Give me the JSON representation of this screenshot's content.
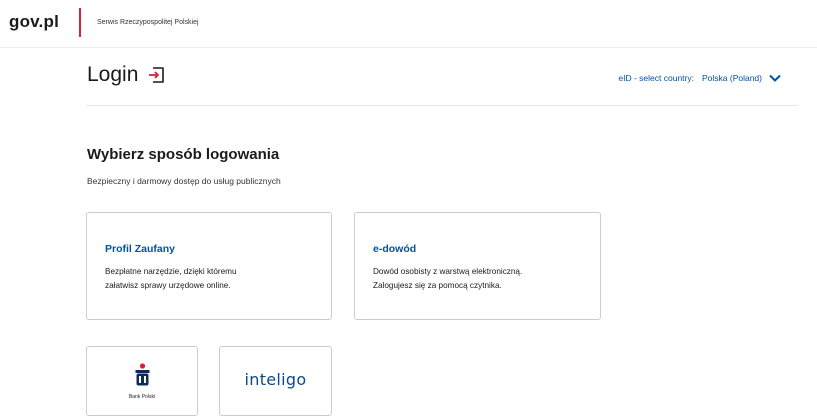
{
  "header": {
    "logo": "gov.pl",
    "service_name": "Serwis Rzeczypospolitej Polskiej"
  },
  "login": {
    "title": "Login",
    "icon": "login-arrow-icon"
  },
  "eid": {
    "label": "eID - select country:",
    "value": "Polska (Poland)",
    "icon": "chevron-down-icon"
  },
  "main": {
    "heading": "Wybierz sposób logowania",
    "subheading": "Bezpieczny i darmowy dostęp do usług publicznych"
  },
  "cards": [
    {
      "title": "Profil Zaufany",
      "desc_line1": "Bezpłatne narzędzie, dzięki któremu",
      "desc_line2": "załatwisz sprawy urzędowe online."
    },
    {
      "title": "e-dowód",
      "desc_line1": "Dowód osobisty z warstwą elektroniczną.",
      "desc_line2": "Zalogujesz się za pomocą czytnika."
    }
  ],
  "banks": [
    {
      "label": "Bank Polski",
      "icon": "pko-bank-logo-icon"
    },
    {
      "label": "inteligo"
    }
  ],
  "colors": {
    "accent_blue": "#0052a5",
    "divider_red": "#d5233a",
    "border": "#c9ccd1"
  }
}
